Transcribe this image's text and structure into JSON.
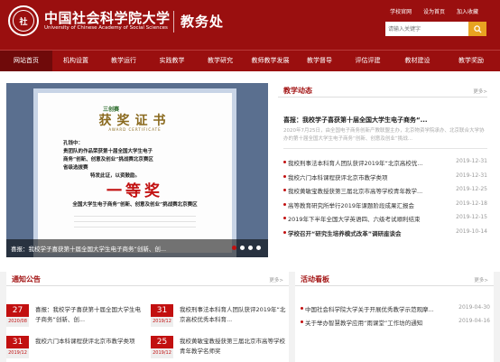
{
  "header": {
    "logo_glyph": "社",
    "cn_name": "中国社会科学院大学",
    "en_name": "University of Chinese Academy of Social Sciences",
    "office": "教务处",
    "links": [
      "学校官网",
      "设为首页",
      "加入收藏"
    ],
    "search_placeholder": "请输入关键字"
  },
  "nav": {
    "items": [
      "网站首页",
      "机构设置",
      "教学运行",
      "实践教学",
      "教学研究",
      "教师教学发展",
      "教学督导",
      "评估评建",
      "教材建设",
      "教学奖励"
    ]
  },
  "slider": {
    "caption": "喜报：我校学子喜获第十届全国大学生电子商务“创新、创...",
    "certificate": {
      "badge": "三创赛",
      "title": "获奖证书",
      "subtitle": "AWARD CERTIFICATE",
      "lines": [
        "孔钱中：",
        "贵团队的作品荣获第十届全国大学生电子",
        "商务“创新、创意及创业”挑战赛北京赛区",
        "省级选拔赛",
        "特发此证，以资鼓励。"
      ],
      "prize": "一等奖",
      "issuer": "全国大学生电子商务“创新、创意及创业”挑战赛北京赛区"
    }
  },
  "news": {
    "title": "教学动态",
    "more": "更多>",
    "headline": "喜报：我校学子喜获第十届全国大学生电子商务“...",
    "summary": "2020年7月25日，由全国电子商务创新产教联盟主办，北京物资学院承办、北京联合大学协办的第十届全国大学生电子商务“创新、创意及创业”挑战...",
    "items": [
      {
        "title": "我校刑事法本科育人团队获评2019年“北京高校优...",
        "date": "2019-12-31",
        "bold": false
      },
      {
        "title": "我校六门本科课程获评北京市教学类项",
        "date": "2019-12-31",
        "bold": false
      },
      {
        "title": "我校黄敏宝教授获第三届北京市高等学校青年教学...",
        "date": "2019-12-25",
        "bold": false
      },
      {
        "title": "高等教育研究所举行2019年课题阶段成果汇报会",
        "date": "2019-12-18",
        "bold": false
      },
      {
        "title": "2019年下半年全国大学英语四、六级考试顺利结束",
        "date": "2019-12-15",
        "bold": false
      },
      {
        "title": "学校召开“研究生培养模式改革”调研座谈会",
        "date": "2019-10-14",
        "bold": true
      }
    ]
  },
  "notices": {
    "title": "通知公告",
    "more": "更多>",
    "items": [
      {
        "day": "27",
        "ym": "2020/08",
        "text": "喜报：我校学子喜获第十届全国大学生电子商务“创新、创..."
      },
      {
        "day": "31",
        "ym": "2019/12",
        "text": "我校刑事法本科育人团队获评2019年“北京高校优秀本科育..."
      },
      {
        "day": "31",
        "ym": "2019/12",
        "text": "我校六门本科课程获评北京市教学类项"
      },
      {
        "day": "25",
        "ym": "2019/12",
        "text": "我校黄敏宝教授获第三届北京市高等学校青年教学名师奖"
      }
    ]
  },
  "activities": {
    "title": "活动看板",
    "more": "更多>",
    "items": [
      {
        "title": "中国社会科学院大学关于开展优秀教学示范观摩...",
        "date": "2019-04-30"
      },
      {
        "title": "关于举办智慧教学应用“雨课堂”工作坊的通知",
        "date": "2019-04-16"
      }
    ]
  },
  "colors": {
    "brand": "#9a0f0f",
    "accent": "#c21010",
    "search_button": "#e8a321"
  }
}
